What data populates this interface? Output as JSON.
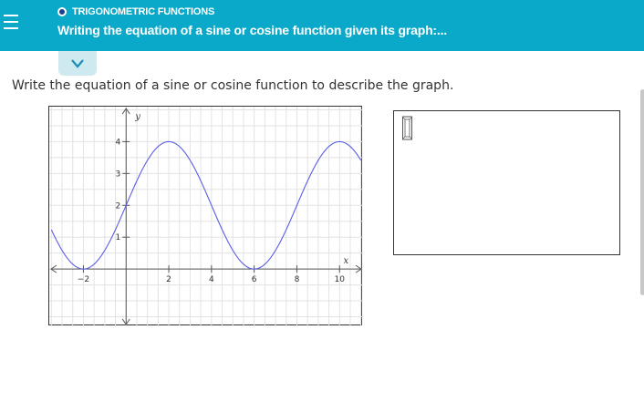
{
  "header": {
    "section_title": "TRIGONOMETRIC FUNCTIONS",
    "topic_title": "Writing the equation of a sine or cosine function given its graph:...",
    "accent_color": "#0aa8c9",
    "dot_color": "#1f3f8f"
  },
  "question": {
    "prompt": "Write the equation of a sine or cosine function to describe the graph."
  },
  "graph": {
    "xlabel": "x",
    "ylabel": "y",
    "x_ticks": [
      -2,
      2,
      4,
      6,
      8,
      10
    ],
    "y_ticks": [
      1,
      2,
      3,
      4
    ],
    "curve_color": "#5a5ee6"
  },
  "chart_data": {
    "type": "line",
    "title": "",
    "xlabel": "x",
    "ylabel": "y",
    "xlim": [
      -3.6,
      11.1
    ],
    "ylim": [
      -1.8,
      5.1
    ],
    "grid": true,
    "x_ticks": [
      -2,
      2,
      4,
      6,
      8,
      10
    ],
    "y_ticks": [
      1,
      2,
      3,
      4
    ],
    "series": [
      {
        "function": "y = 2 - 2*cos(pi*(x + 2)/4)",
        "x_range": [
          -3.5,
          11.0
        ]
      }
    ]
  },
  "answer": {
    "value": ""
  },
  "icons": {
    "menu": "menu-icon",
    "expand": "chevron-down-icon",
    "input": "math-template-icon"
  }
}
